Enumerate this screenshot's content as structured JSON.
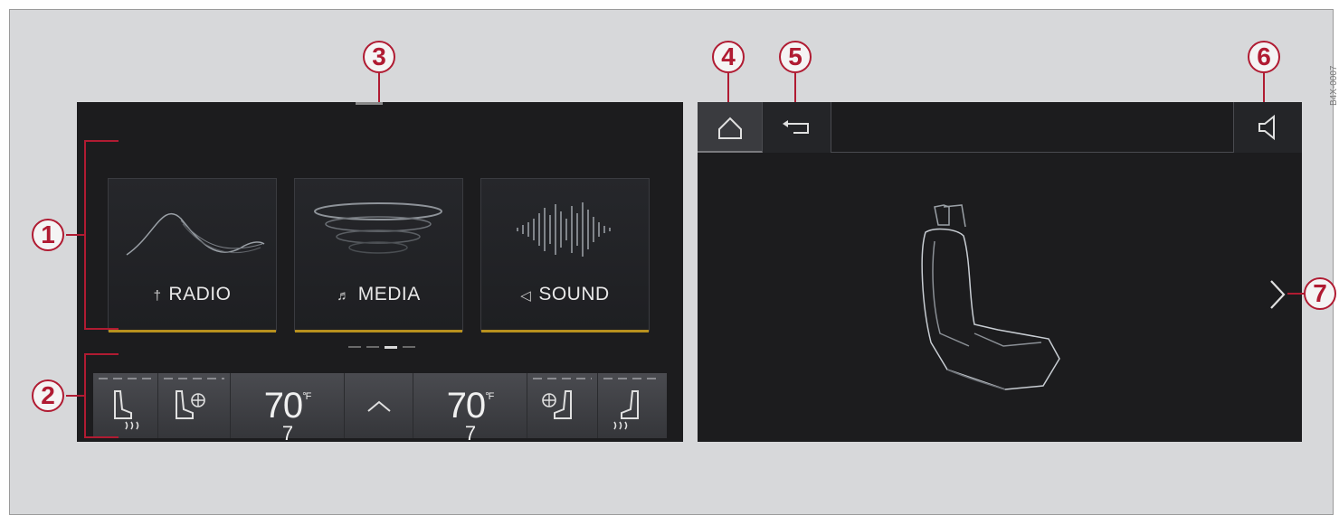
{
  "callouts": {
    "c1": "1",
    "c2": "2",
    "c3": "3",
    "c4": "4",
    "c5": "5",
    "c6": "6",
    "c7": "7"
  },
  "left_screen": {
    "tiles": [
      {
        "label": "RADIO",
        "icon": "antenna-icon",
        "icon_glyph": "†"
      },
      {
        "label": "MEDIA",
        "icon": "music-note-icon",
        "icon_glyph": "♬"
      },
      {
        "label": "SOUND",
        "icon": "speaker-icon",
        "icon_glyph": "◁"
      }
    ],
    "page_indicator": {
      "count": 4,
      "active": 2
    },
    "climate": {
      "left_temp": "70",
      "left_unit": "°F",
      "left_decimal": "7",
      "right_temp": "70",
      "right_unit": "°F",
      "right_decimal": "7",
      "expand_icon": "chevron-up-icon"
    }
  },
  "right_screen": {
    "buttons": [
      "home-icon",
      "back-icon",
      "speaker-icon"
    ],
    "next_icon": "chevron-right-icon"
  },
  "stamp": "B4X-0007",
  "colors": {
    "callout": "#b01b32",
    "accent_bar": "#b7901e",
    "screen_bg": "#1c1c1e",
    "frame_bg": "#d7d8da"
  }
}
